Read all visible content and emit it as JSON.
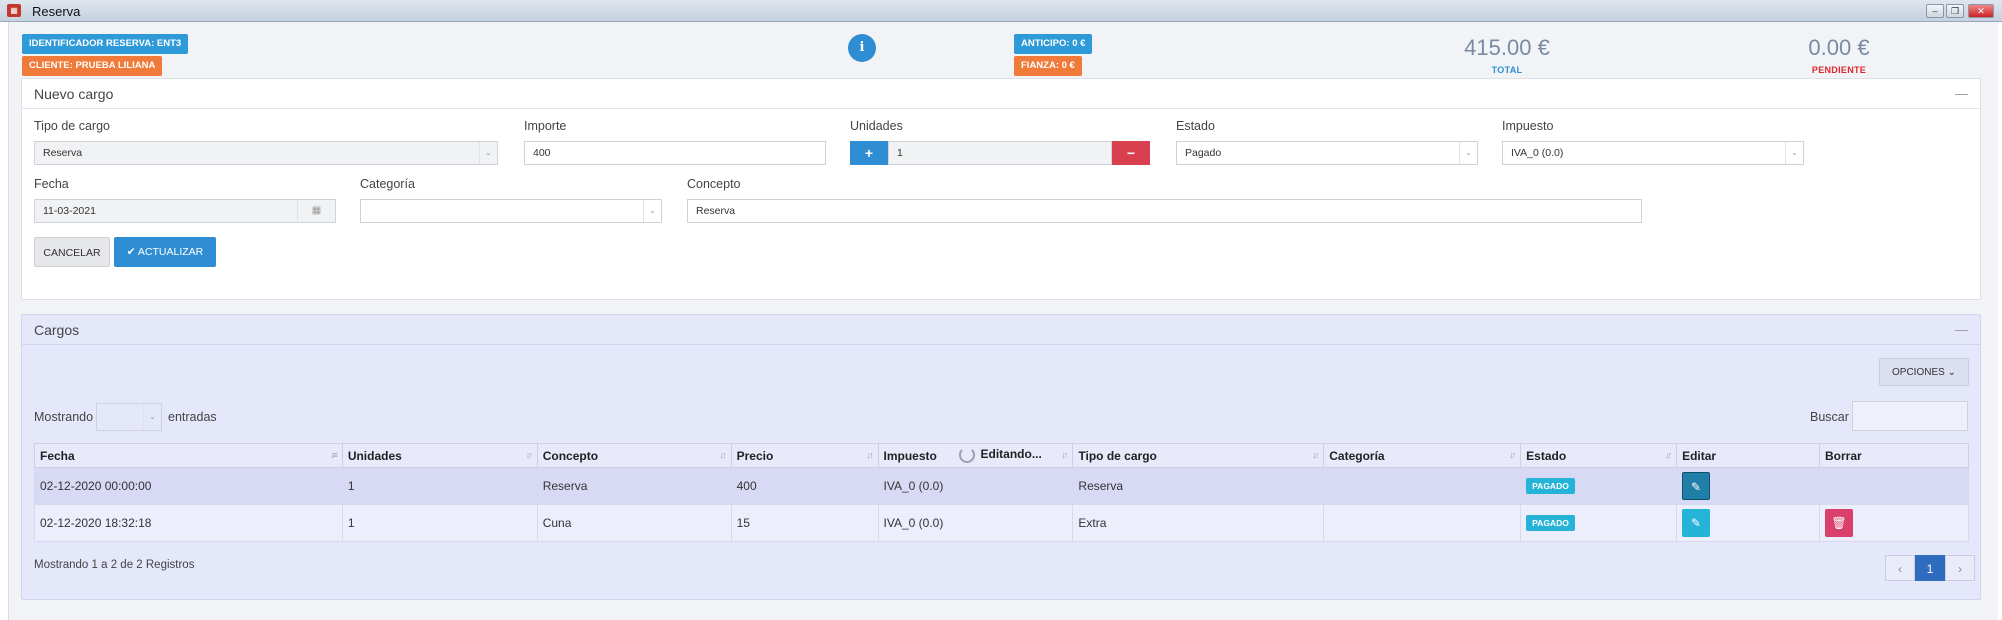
{
  "window": {
    "title": "Reserva"
  },
  "header": {
    "reservation_id_badge": "IDENTIFICADOR RESERVA: ENT3",
    "client_badge": "CLIENTE: PRUEBA LILIANA",
    "info_glyph": "i",
    "anticipo_badge": "ANTICIPO: 0 €",
    "fianza_badge": "FIANZA: 0 €",
    "total_amount": "415.00 €",
    "total_label": "TOTAL",
    "pending_amount": "0.00 €",
    "pending_label": "PENDIENTE",
    "colors": {
      "blue": "#2f9ad8",
      "orange": "#ef7a3a",
      "pending": "#e0262b",
      "total": "#2f8ed3"
    }
  },
  "nuevo_cargo": {
    "title": "Nuevo cargo",
    "collapse_glyph": "—",
    "tipo_label": "Tipo de cargo",
    "tipo_value": "Reserva",
    "importe_label": "Importe",
    "importe_value": "400",
    "unidades_label": "Unidades",
    "unidades_value": "1",
    "plus_glyph": "+",
    "minus_glyph": "−",
    "estado_label": "Estado",
    "estado_value": "Pagado",
    "impuesto_label": "Impuesto",
    "impuesto_value": "IVA_0 (0.0)",
    "fecha_label": "Fecha",
    "fecha_value": "11-03-2021",
    "categoria_label": "Categoría",
    "categoria_value": "",
    "concepto_label": "Concepto",
    "concepto_value": "Reserva",
    "cancel_label": "CANCELAR",
    "update_label": "ACTUALIZAR",
    "check_glyph": "✔",
    "caret_glyph": "⌄",
    "calendar_glyph": "▦"
  },
  "cargos": {
    "title": "Cargos",
    "collapse_glyph": "—",
    "options_label": "OPCIONES",
    "showing_label": "Mostrando",
    "entries_label": "entradas",
    "page_size_value": "",
    "search_label": "Buscar",
    "search_value": "",
    "columns": [
      "Fecha",
      "Unidades",
      "Concepto",
      "Precio",
      "Impuesto",
      "Editando...",
      "Tipo de cargo",
      "Categoría",
      "Estado",
      "Editar",
      "Borrar"
    ],
    "rows": [
      {
        "fecha": "02-12-2020 00:00:00",
        "unidades": "1",
        "concepto": "Reserva",
        "precio": "400",
        "impuesto": "IVA_0 (0.0)",
        "tipo": "Reserva",
        "categoria": "",
        "estado": "PAGADO"
      },
      {
        "fecha": "02-12-2020 18:32:18",
        "unidades": "1",
        "concepto": "Cuna",
        "precio": "15",
        "impuesto": "IVA_0 (0.0)",
        "tipo": "Extra",
        "categoria": "",
        "estado": "PAGADO"
      }
    ],
    "footer": "Mostrando 1 a 2 de 2 Registros",
    "pager": {
      "prev": "‹",
      "current": "1",
      "next": "›"
    }
  }
}
